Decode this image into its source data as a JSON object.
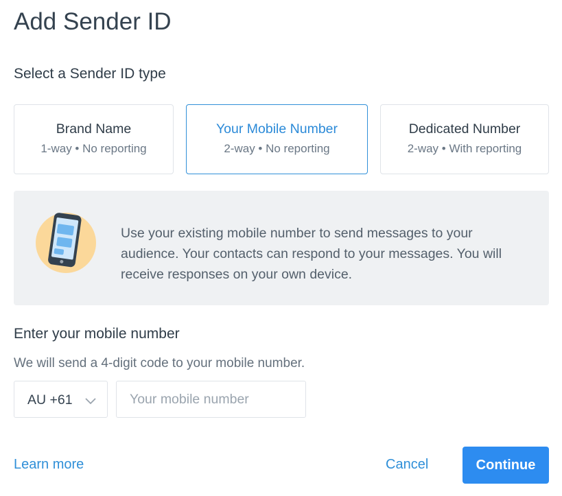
{
  "dialog": {
    "title": "Add Sender ID"
  },
  "type_section": {
    "label": "Select a Sender ID type",
    "options": [
      {
        "title": "Brand Name",
        "subtitle": "1-way • No reporting",
        "selected": false
      },
      {
        "title": "Your Mobile Number",
        "subtitle": "2-way • No reporting",
        "selected": true
      },
      {
        "title": "Dedicated Number",
        "subtitle": "2-way • With reporting",
        "selected": false
      }
    ]
  },
  "info": {
    "icon": "mobile-phone-illustration",
    "text": "Use your existing mobile number to send messages to your audience. Your contacts can respond to your messages. You will receive responses on your own device."
  },
  "mobile_section": {
    "label": "Enter your mobile number",
    "hint": "We will send a 4-digit code to your mobile number.",
    "country_code": "AU +61",
    "input_value": "",
    "input_placeholder": "Your mobile number"
  },
  "footer": {
    "learn_more": "Learn more",
    "cancel": "Cancel",
    "continue": "Continue"
  },
  "colors": {
    "accent": "#2d8cf0",
    "link": "#2f8fd8",
    "info_bg": "#eff1f3",
    "illustration_bg": "#fbd89a"
  }
}
